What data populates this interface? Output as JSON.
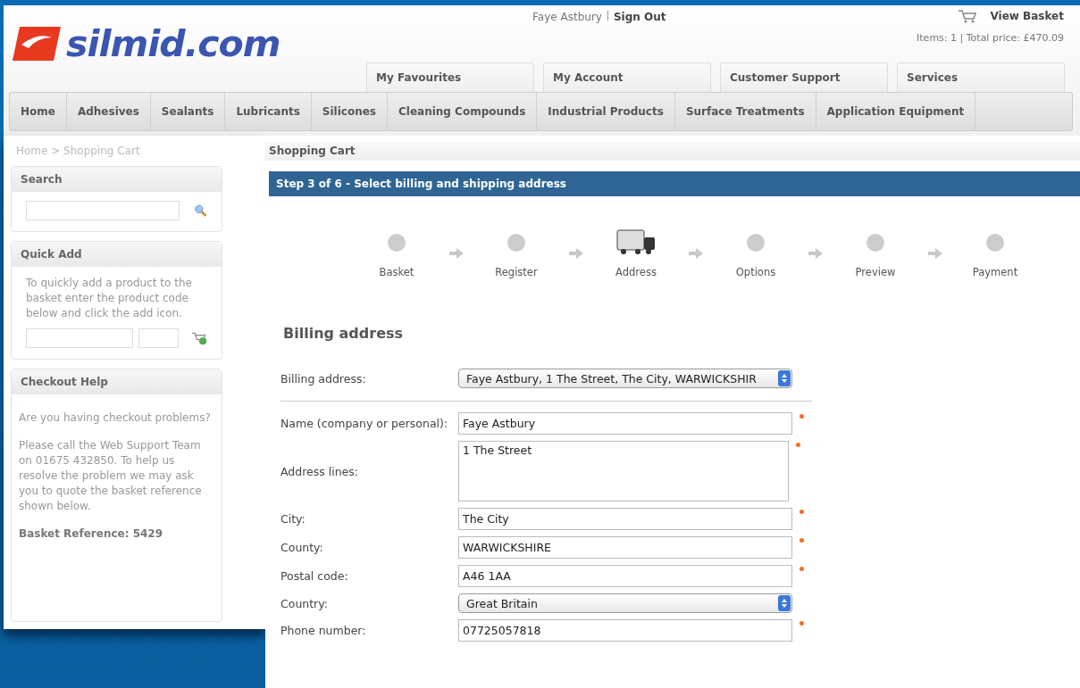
{
  "header": {
    "logo": "silmid.com",
    "user": "Faye Astbury",
    "sign_out": "Sign Out",
    "view_basket": "View Basket",
    "basket_summary": "Items: 1  |  Total price: £470.09",
    "tabs": [
      "My Favourites",
      "My Account",
      "Customer Support",
      "Services"
    ]
  },
  "nav": [
    "Home",
    "Adhesives",
    "Sealants",
    "Lubricants",
    "Silicones",
    "Cleaning Compounds",
    "Industrial Products",
    "Surface Treatments",
    "Application Equipment"
  ],
  "breadcrumb": "Home > Shopping Cart",
  "sidebar": {
    "search": {
      "title": "Search"
    },
    "quick_add": {
      "title": "Quick Add",
      "text": "To quickly add a product to the basket enter the product code below and click the add icon."
    },
    "help": {
      "title": "Checkout Help",
      "paragraphs": [
        "Are you having checkout problems?",
        "Please call the Web Support Team on 01675 432850. To help us resolve the problem we may ask you to quote the basket reference shown below."
      ],
      "reference": "Basket Reference: 5429"
    }
  },
  "page_title": "Shopping Cart",
  "step_banner": "Step 3 of 6 - Select billing and shipping address",
  "steps": [
    {
      "label": "Basket",
      "selected": false
    },
    {
      "label": "Register",
      "selected": false
    },
    {
      "label": "Address",
      "selected": true
    },
    {
      "label": "Options",
      "selected": false
    },
    {
      "label": "Preview",
      "selected": false
    },
    {
      "label": "Payment",
      "selected": false
    }
  ],
  "billing": {
    "heading": "Billing address",
    "fields": [
      {
        "kind": "select",
        "label": "Billing address:",
        "value": "Faye Astbury, 1 The Street, The City, WARWICKSHIR",
        "required": false
      },
      {
        "kind": "text",
        "label": "Name (company or personal):",
        "value": "Faye Astbury",
        "required": true
      },
      {
        "kind": "textarea",
        "label": "Address lines:",
        "value": "1 The Street",
        "required": true
      },
      {
        "kind": "text",
        "label": "City:",
        "value": "The City",
        "required": true
      },
      {
        "kind": "text",
        "label": "County:",
        "value": "WARWICKSHIRE",
        "required": true
      },
      {
        "kind": "text",
        "label": "Postal code:",
        "value": "A46 1AA",
        "required": true
      },
      {
        "kind": "select",
        "label": "Country:",
        "value": "Great Britain",
        "required": false
      },
      {
        "kind": "text",
        "label": "Phone number:",
        "value": "07725057818",
        "required": true
      }
    ]
  }
}
